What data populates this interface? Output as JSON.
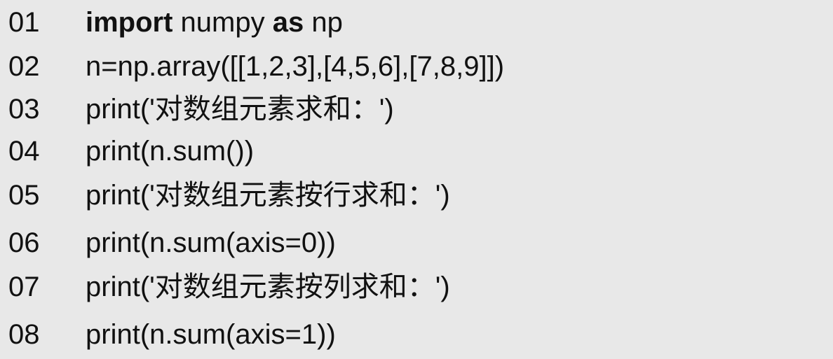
{
  "lines": [
    {
      "number": "01",
      "segments": [
        {
          "text": "import",
          "keyword": true
        },
        {
          "text": " numpy ",
          "keyword": false
        },
        {
          "text": "as",
          "keyword": true
        },
        {
          "text": " np",
          "keyword": false
        }
      ]
    },
    {
      "number": "02",
      "code": "n=np.array([[1,2,3],[4,5,6],[7,8,9]])"
    },
    {
      "number": "03",
      "code": "print('对数组元素求和：')"
    },
    {
      "number": "04",
      "code": "print(n.sum())"
    },
    {
      "number": "05",
      "code": "print('对数组元素按行求和：')"
    },
    {
      "number": "06",
      "code": "print(n.sum(axis=0))"
    },
    {
      "number": "07",
      "code": "print('对数组元素按列求和：')"
    },
    {
      "number": "08",
      "code": "print(n.sum(axis=1))"
    }
  ]
}
